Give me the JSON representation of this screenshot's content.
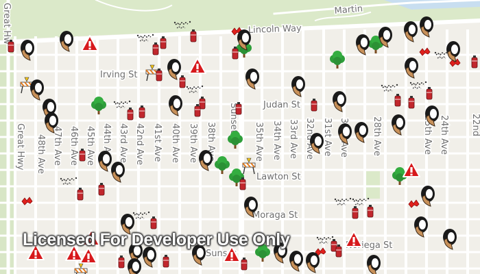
{
  "map": {
    "watermark": "Licensed For Developer Use Only",
    "streets": {
      "lincoln": "Lincoln Way",
      "martin": "Martin",
      "irving": "Irving St",
      "judan": "Judan St",
      "lawton": "Lawton St",
      "moraga": "Moraga St",
      "noriega": "Noriega St",
      "sunset": "Sunset",
      "great_hwy_top": "Great Hw",
      "great_hwy": "Great Hwy",
      "ave48": "48th Ave",
      "ave47": "47th Ave",
      "ave46": "46th Ave",
      "ave45": "45th Ave",
      "ave44": "44th Ave",
      "ave43": "43rd Ave",
      "ave42": "42nd Ave",
      "ave41": "41st Ave",
      "ave40": "40th Ave",
      "ave39": "39th Ave",
      "ave38": "38th Ave",
      "ave35": "35th Ave",
      "ave34": "34th Ave",
      "ave33": "33rd Ave",
      "ave32": "32nd Ave",
      "ave31": "31st Ave",
      "ave30": "30th Ave",
      "ave28": "28th Ave",
      "ave25": "25th Ave",
      "ave24": "24th Ave",
      "ave22": "22nd"
    },
    "symbol_types": [
      "pothole-icon",
      "tree-icon",
      "alert-triangle-icon",
      "fire-extinguisher-icon",
      "graffiti-icon",
      "road-barrier-icon"
    ],
    "colors": {
      "background": "#f1efe9",
      "street": "#ffffff",
      "park": "#dbe9c9",
      "alert": "#d7191c",
      "tree": "#2e9e3a"
    }
  }
}
